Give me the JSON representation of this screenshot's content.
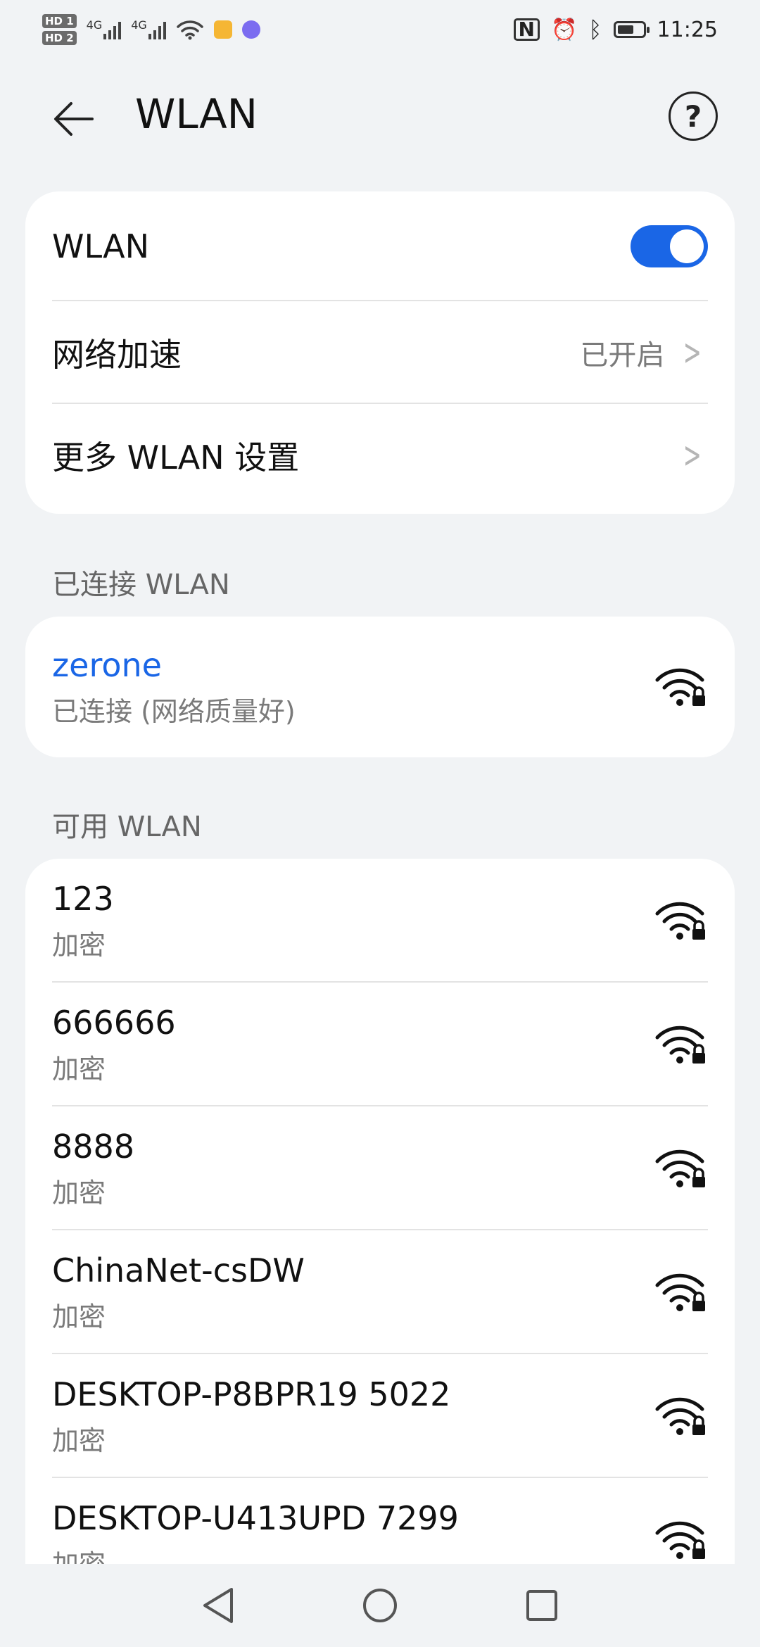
{
  "status_bar": {
    "hd1": "HD 1",
    "hd2": "HD 2",
    "net1": "4G",
    "net2": "4G",
    "time": "11:25"
  },
  "header": {
    "title": "WLAN",
    "help_label": "?"
  },
  "settings": {
    "wlan_label": "WLAN",
    "wlan_enabled": true,
    "acceleration_label": "网络加速",
    "acceleration_value": "已开启",
    "more_label": "更多 WLAN 设置"
  },
  "connected_section": {
    "title": "已连接 WLAN",
    "network": {
      "ssid": "zerone",
      "status": "已连接 (网络质量好)"
    }
  },
  "available_section": {
    "title": "可用 WLAN",
    "networks": [
      {
        "ssid": "123",
        "security": "加密"
      },
      {
        "ssid": "666666",
        "security": "加密"
      },
      {
        "ssid": "8888",
        "security": "加密"
      },
      {
        "ssid": "ChinaNet-csDW",
        "security": "加密"
      },
      {
        "ssid": "DESKTOP-P8BPR19 5022",
        "security": "加密"
      },
      {
        "ssid": "DESKTOP-U413UPD 7299",
        "security": "加密"
      }
    ]
  },
  "colors": {
    "accent": "#1a66e6",
    "background": "#f1f3f5"
  },
  "icons": {
    "back": "back-arrow-icon",
    "help": "help-icon",
    "wifi_locked": "wifi-lock-icon",
    "chevron": "chevron-right-icon",
    "nav_back": "nav-back-icon",
    "nav_home": "nav-home-icon",
    "nav_recents": "nav-recents-icon"
  }
}
